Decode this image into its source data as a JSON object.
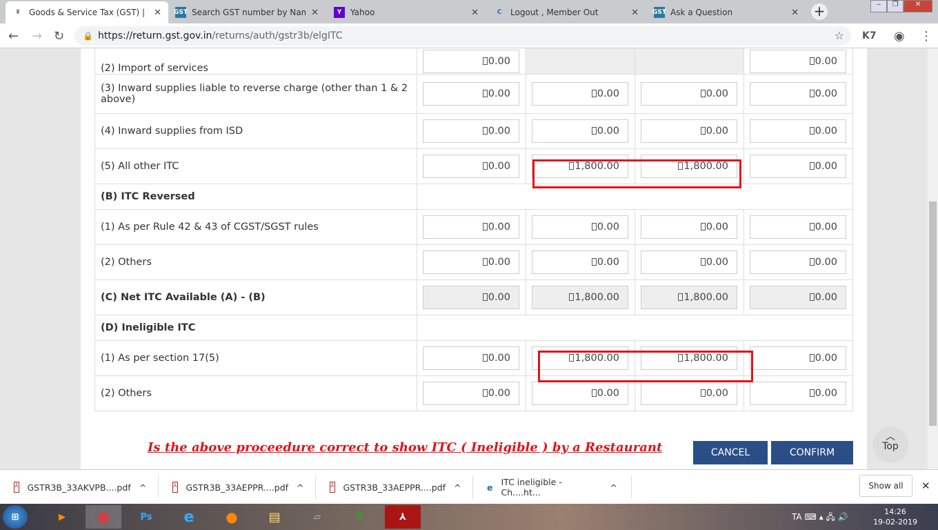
{
  "browser": {
    "tabs": [
      {
        "title": "Goods & Service Tax (GST) | User",
        "icon": "emblem-icon",
        "active": true
      },
      {
        "title": "Search GST number by Name o",
        "icon": "gst-icon"
      },
      {
        "title": "Yahoo",
        "icon": "yahoo-icon"
      },
      {
        "title": "Logout , Member Out",
        "icon": "site-icon"
      },
      {
        "title": "Ask a Question",
        "icon": "gst-icon"
      }
    ],
    "url_host": "https://return.gst.gov.in",
    "url_path": "/returns/auth/gstr3b/elgITC"
  },
  "table": {
    "rows": [
      {
        "label": "(2) Import of services",
        "cells": [
          "0.00",
          null,
          null,
          "0.00"
        ]
      },
      {
        "label": "(3) Inward supplies liable to reverse charge (other than 1 & 2 above)",
        "cells": [
          "0.00",
          "0.00",
          "0.00",
          "0.00"
        ]
      },
      {
        "label": "(4) Inward supplies from ISD",
        "cells": [
          "0.00",
          "0.00",
          "0.00",
          "0.00"
        ]
      },
      {
        "label": "(5) All other ITC",
        "cells": [
          "0.00",
          "1,800.00",
          "1,800.00",
          "0.00"
        ]
      },
      {
        "label": "(B) ITC Reversed",
        "header": true
      },
      {
        "label": "(1) As per Rule 42 & 43 of CGST/SGST rules",
        "cells": [
          "0.00",
          "0.00",
          "0.00",
          "0.00"
        ]
      },
      {
        "label": "(2) Others",
        "cells": [
          "0.00",
          "0.00",
          "0.00",
          "0.00"
        ]
      },
      {
        "label": "(C) Net ITC Available (A) - (B)",
        "bold": true,
        "disabled": true,
        "cells": [
          "0.00",
          "1,800.00",
          "1,800.00",
          "0.00"
        ]
      },
      {
        "label": "(D) Ineligible ITC",
        "header": true
      },
      {
        "label": "(1) As per section 17(5)",
        "cells": [
          "0.00",
          "1,800.00",
          "1,800.00",
          "0.00"
        ]
      },
      {
        "label": "(2) Others",
        "cells": [
          "0.00",
          "0.00",
          "0.00",
          "0.00"
        ]
      }
    ]
  },
  "annotation": "Is the above proceedure  correct  to show  ITC ( Ineligible ) by a Restaurant",
  "buttons": {
    "cancel": "CANCEL",
    "confirm": "CONFIRM",
    "top": "Top"
  },
  "downloads": [
    {
      "name": "GSTR3B_33AKVPB....pdf",
      "icon": "pdf-icon"
    },
    {
      "name": "GSTR3B_33AEPPR....pdf",
      "icon": "pdf-icon"
    },
    {
      "name": "GSTR3B_33AEPPR....pdf",
      "icon": "pdf-icon"
    },
    {
      "name": "ITC ineligible - Ch....ht...",
      "icon": "ie-icon"
    }
  ],
  "show_all": "Show all",
  "taskbar": {
    "lang": "TA",
    "time": "14:26",
    "date": "19-02-2019"
  },
  "colors": {
    "accent": "#2c4e86",
    "highlight": "#e0131a"
  }
}
